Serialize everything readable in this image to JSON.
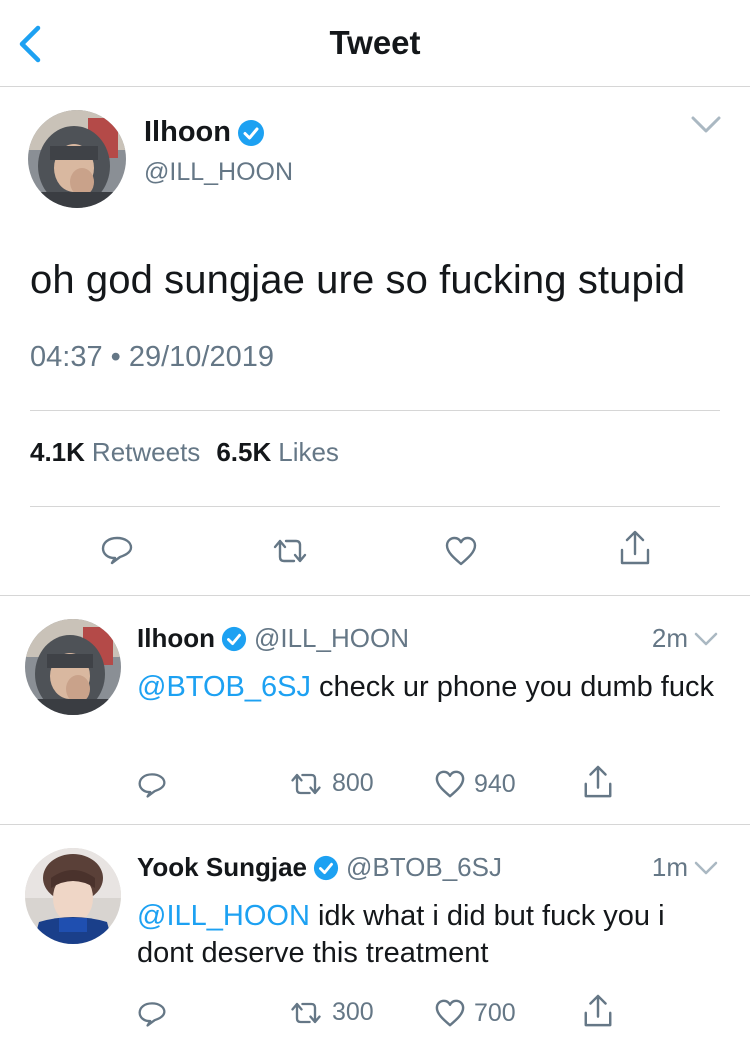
{
  "nav": {
    "title": "Tweet",
    "back_icon": "chevron-left-icon"
  },
  "main_tweet": {
    "name": "Ilhoon",
    "handle": "@ILL_HOON",
    "text": "oh god sungjae ure so fucking stupid",
    "time": "04:37",
    "date": "29/10/2019",
    "separator": "•",
    "retweets_count": "4.1K",
    "retweets_label": "Retweets",
    "likes_count": "6.5K",
    "likes_label": "Likes",
    "actions": [
      "reply-icon",
      "retweet-icon",
      "like-icon",
      "share-icon"
    ]
  },
  "replies": [
    {
      "name": "Ilhoon",
      "handle": "@ILL_HOON",
      "time": "2m",
      "mention": "@BTOB_6SJ",
      "text": " check ur phone you dumb fuck",
      "retweets": "800",
      "likes": "940"
    },
    {
      "name": "Yook Sungjae",
      "handle": "@BTOB_6SJ",
      "time": "1m",
      "mention": "@ILL_HOON",
      "text": " idk what i did but fuck you i dont deserve this treatment",
      "retweets": "300",
      "likes": "700"
    }
  ],
  "colors": {
    "accent": "#1da1f2",
    "secondary_text": "#657786",
    "primary_text": "#14171a",
    "divider": "#d6d6d6"
  }
}
